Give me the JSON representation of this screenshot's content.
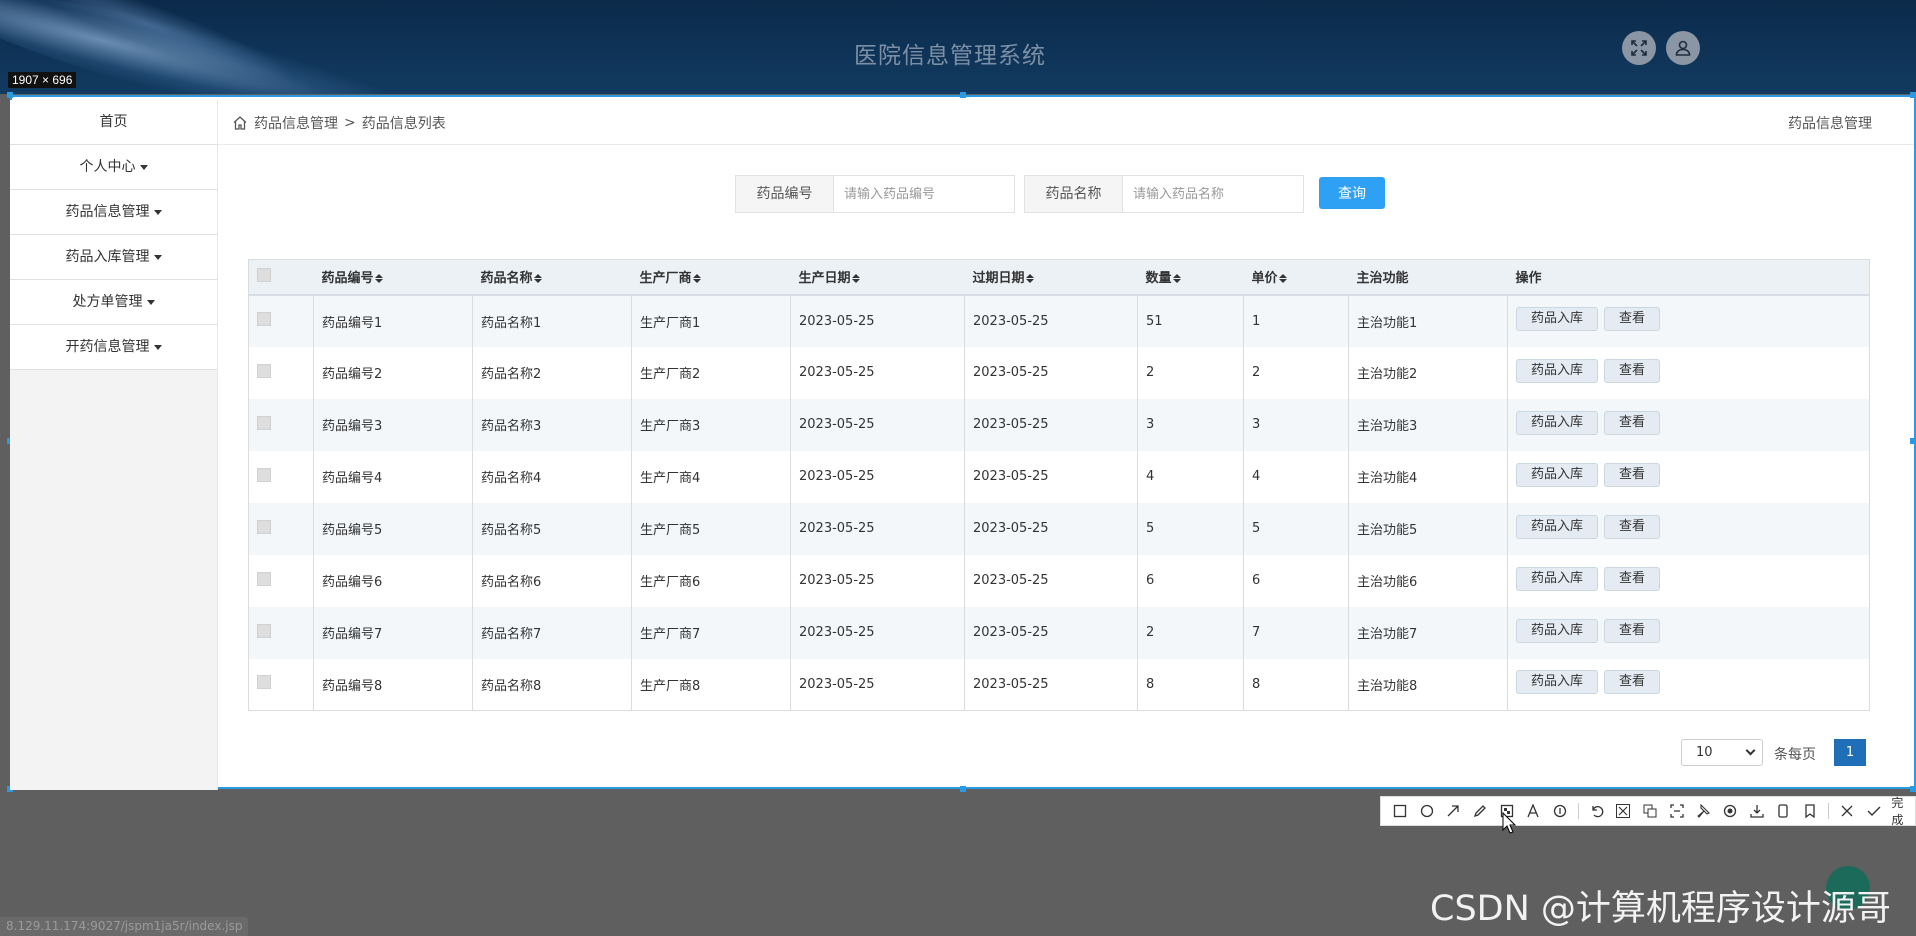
{
  "header": {
    "title": "医院信息管理系统"
  },
  "capture": {
    "size_label": "1907 × 696"
  },
  "sidebar": {
    "items": [
      {
        "label": "首页",
        "dropdown": false
      },
      {
        "label": "个人中心",
        "dropdown": true
      },
      {
        "label": "药品信息管理",
        "dropdown": true
      },
      {
        "label": "药品入库管理",
        "dropdown": true
      },
      {
        "label": "处方单管理",
        "dropdown": true
      },
      {
        "label": "开药信息管理",
        "dropdown": true
      }
    ]
  },
  "breadcrumb": {
    "root": "药品信息管理",
    "separator": ">",
    "current": "药品信息列表",
    "right": "药品信息管理"
  },
  "search": {
    "code_label": "药品编号",
    "code_placeholder": "请输入药品编号",
    "name_label": "药品名称",
    "name_placeholder": "请输入药品名称",
    "query_label": "查询"
  },
  "table": {
    "columns": [
      "药品编号",
      "药品名称",
      "生产厂商",
      "生产日期",
      "过期日期",
      "数量",
      "单价",
      "主治功能",
      "操作"
    ],
    "rows": [
      [
        "药品编号1",
        "药品名称1",
        "生产厂商1",
        "2023-05-25",
        "2023-05-25",
        "51",
        "1",
        "主治功能1"
      ],
      [
        "药品编号2",
        "药品名称2",
        "生产厂商2",
        "2023-05-25",
        "2023-05-25",
        "2",
        "2",
        "主治功能2"
      ],
      [
        "药品编号3",
        "药品名称3",
        "生产厂商3",
        "2023-05-25",
        "2023-05-25",
        "3",
        "3",
        "主治功能3"
      ],
      [
        "药品编号4",
        "药品名称4",
        "生产厂商4",
        "2023-05-25",
        "2023-05-25",
        "4",
        "4",
        "主治功能4"
      ],
      [
        "药品编号5",
        "药品名称5",
        "生产厂商5",
        "2023-05-25",
        "2023-05-25",
        "5",
        "5",
        "主治功能5"
      ],
      [
        "药品编号6",
        "药品名称6",
        "生产厂商6",
        "2023-05-25",
        "2023-05-25",
        "6",
        "6",
        "主治功能6"
      ],
      [
        "药品编号7",
        "药品名称7",
        "生产厂商7",
        "2023-05-25",
        "2023-05-25",
        "2",
        "7",
        "主治功能7"
      ],
      [
        "药品编号8",
        "药品名称8",
        "生产厂商8",
        "2023-05-25",
        "2023-05-25",
        "8",
        "8",
        "主治功能8"
      ]
    ],
    "actions": {
      "stock_in": "药品入库",
      "view": "查看"
    }
  },
  "pager": {
    "page_size": "10",
    "per_page_label": "条每页",
    "current_page": "1"
  },
  "toolbar": {
    "done_label": "完成"
  },
  "status_url": "8.129.11.174:9027/jspm1ja5r/index.jsp",
  "watermark": "CSDN @计算机程序设计源哥",
  "colors": {
    "accent": "#2ea1f5",
    "header_bg": "#0f3458",
    "page_active": "#1e6fb8"
  }
}
